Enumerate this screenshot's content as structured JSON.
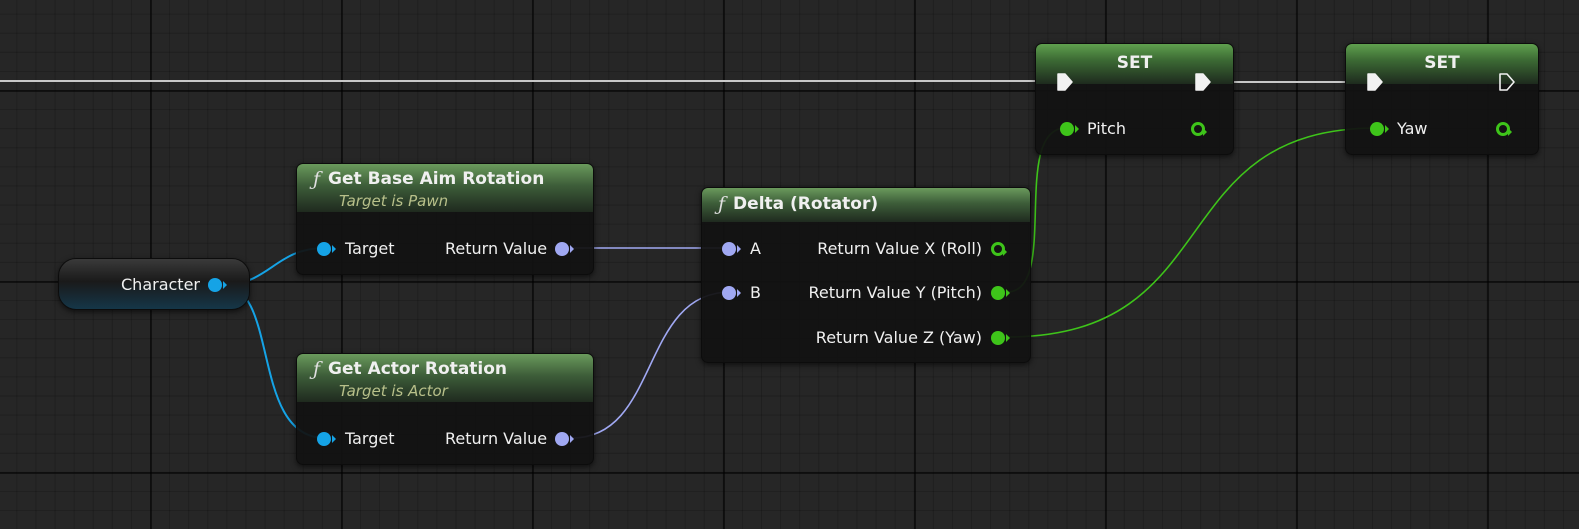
{
  "nodes": {
    "character": {
      "label": "Character"
    },
    "get_base_aim_rotation": {
      "title": "Get Base Aim Rotation",
      "subtitle": "Target is Pawn",
      "input_label": "Target",
      "output_label": "Return Value"
    },
    "get_actor_rotation": {
      "title": "Get Actor Rotation",
      "subtitle": "Target is Actor",
      "input_label": "Target",
      "output_label": "Return Value"
    },
    "delta_rotator": {
      "title": "Delta (Rotator)",
      "inputs": [
        "A",
        "B"
      ],
      "outputs": [
        "Return Value X (Roll)",
        "Return Value Y (Pitch)",
        "Return Value Z (Yaw)"
      ]
    },
    "set_pitch": {
      "title": "SET",
      "var_label": "Pitch"
    },
    "set_yaw": {
      "title": "SET",
      "var_label": "Yaw"
    },
    "function_icon": "ƒ"
  },
  "colors": {
    "object_pin": "#15a3e6",
    "rotator_pin": "#a0a8f2",
    "float_pin": "#3ec41a",
    "exec_wire": "#c8c8c8",
    "node_header_green": "#4f7a45"
  },
  "icons": [
    "function-icon",
    "exec-pin-icon",
    "object-pin-icon",
    "rotator-pin-icon",
    "float-pin-icon"
  ]
}
